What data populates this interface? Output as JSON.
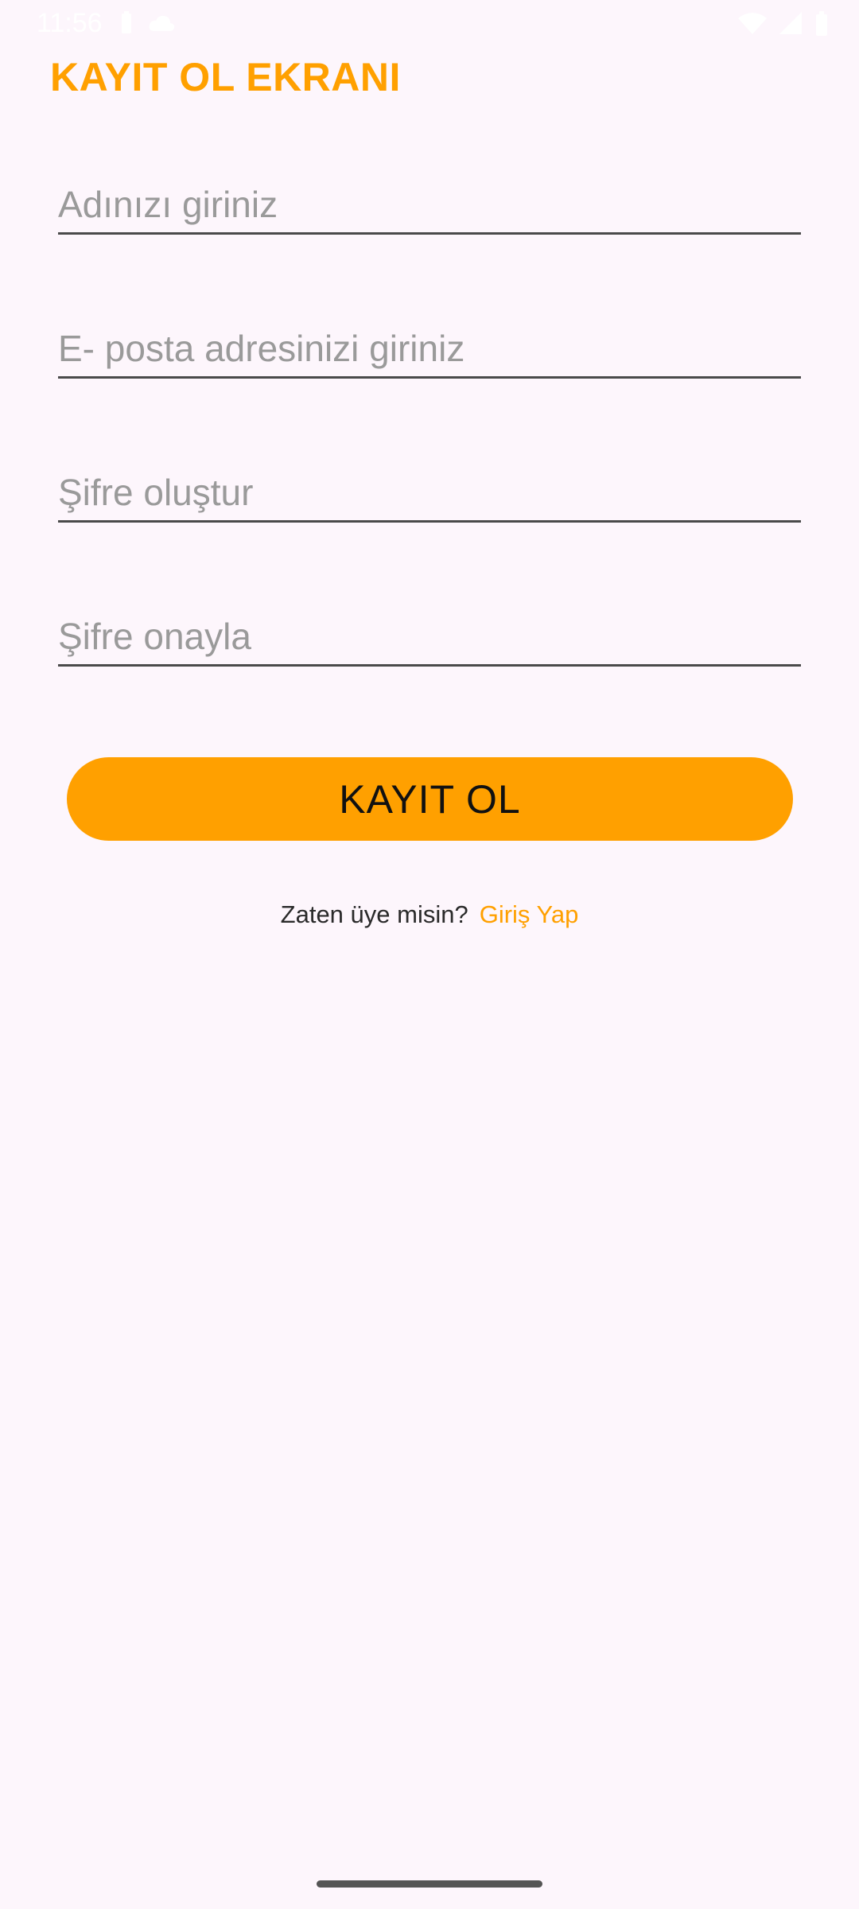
{
  "status_bar": {
    "time": "11:56",
    "icon_names": [
      "battery-saver-icon",
      "cloud-icon",
      "wifi-icon",
      "signal-icon",
      "battery-icon"
    ]
  },
  "screen": {
    "title": "KAYIT OL EKRANI"
  },
  "form": {
    "name_placeholder": "Adınızı giriniz",
    "email_placeholder": "E- posta adresinizi giriniz",
    "password_placeholder": "Şifre oluştur",
    "confirm_placeholder": "Şifre onayla",
    "name_value": "",
    "email_value": "",
    "password_value": "",
    "confirm_value": ""
  },
  "actions": {
    "register_label": "KAYIT OL",
    "login_prompt": "Zaten üye misin?",
    "login_link": "Giriş Yap"
  },
  "colors": {
    "accent": "#ffa000",
    "background": "#fdf6fc",
    "field_underline": "#4a4a4a",
    "placeholder": "#9a9a9a"
  }
}
